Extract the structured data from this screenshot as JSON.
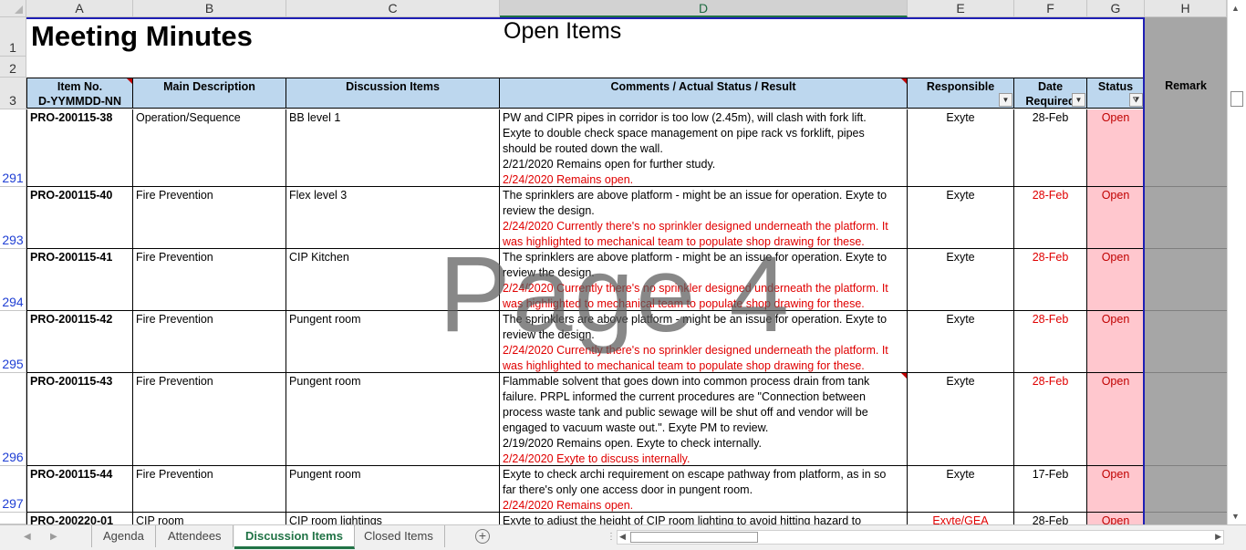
{
  "columns": [
    "A",
    "B",
    "C",
    "D",
    "E",
    "F",
    "G",
    "H"
  ],
  "selected_column": "D",
  "row_numbers": [
    "1",
    "2",
    "3",
    "291",
    "293",
    "294",
    "295",
    "296",
    "297"
  ],
  "title": "Meeting Minutes",
  "subtitle": "Open Items",
  "watermark": "Page 4",
  "headers": {
    "item_no": "Item No.",
    "item_no_format": "D-YYMMDD-NN",
    "main_description": "Main Description",
    "discussion_items": "Discussion Items",
    "comments": "Comments / Actual Status / Result",
    "responsible": "Responsible",
    "date_required": "Date Required",
    "status": "Status",
    "remark": "Remark"
  },
  "rows": [
    {
      "item": "PRO-200115-38",
      "main": "Operation/Sequence",
      "discussion": "BB level 1",
      "comment_lines": [
        "PW and CIPR pipes in corridor is too low (2.45m), will clash with fork lift.",
        "Exyte to double check space management on pipe rack vs forklift, pipes",
        "should be routed down the wall.",
        "2/21/2020 Remains open for further study."
      ],
      "comment_red": [
        "2/24/2020 Remains open."
      ],
      "responsible": "Exyte",
      "date": "28-Feb",
      "status": "Open"
    },
    {
      "item": "PRO-200115-40",
      "main": "Fire Prevention",
      "discussion": "Flex level 3",
      "comment_lines": [
        "The sprinklers are above platform - might be an issue for operation. Exyte to",
        "review the design."
      ],
      "comment_red": [
        "2/24/2020 Currently there's no sprinkler designed underneath the platform. It",
        "was highlighted to mechanical team to populate shop drawing for these."
      ],
      "responsible": "Exyte",
      "date": "28-Feb",
      "status": "Open"
    },
    {
      "item": "PRO-200115-41",
      "main": "Fire Prevention",
      "discussion": "CIP Kitchen",
      "comment_lines": [
        "The sprinklers are above platform - might be an issue for operation. Exyte to",
        "review the design."
      ],
      "comment_red": [
        "2/24/2020 Currently there's no sprinkler designed underneath the platform. It",
        "was highlighted to mechanical team to populate shop drawing for these."
      ],
      "responsible": "Exyte",
      "date": "28-Feb",
      "status": "Open"
    },
    {
      "item": "PRO-200115-42",
      "main": "Fire Prevention",
      "discussion": "Pungent room",
      "comment_lines": [
        "The sprinklers are above platform - might be an issue for operation. Exyte to",
        "review the design."
      ],
      "comment_red": [
        "2/24/2020 Currently there's no sprinkler designed underneath the platform. It",
        "was highlighted to mechanical team to populate shop drawing for these."
      ],
      "responsible": "Exyte",
      "date": "28-Feb",
      "status": "Open"
    },
    {
      "item": "PRO-200115-43",
      "main": "Fire Prevention",
      "discussion": "Pungent room",
      "comment_lines": [
        "Flammable solvent that goes down into common process drain from tank",
        "failure. PRPL informed the current procedures are \"Connection between",
        "process waste tank and public sewage will be shut off and vendor will be",
        "engaged to vacuum waste out.\". Exyte PM to review.",
        "2/19/2020 Remains open. Exyte to check internally."
      ],
      "comment_red": [
        "2/24/2020 Exyte to discuss internally."
      ],
      "responsible": "Exyte",
      "date": "28-Feb",
      "status": "Open"
    },
    {
      "item": "PRO-200115-44",
      "main": "Fire Prevention",
      "discussion": "Pungent room",
      "comment_lines": [
        "Exyte to check archi requirement on escape pathway from platform, as in so",
        "far there's only one access door in pungent room."
      ],
      "comment_red": [
        "2/24/2020 Remains open."
      ],
      "responsible": "Exyte",
      "date": "17-Feb",
      "status": "Open"
    },
    {
      "item": "PRO-200220-01",
      "main": "CIP room",
      "discussion": "CIP room lightings",
      "comment_lines": [
        "Exyte to adjust the height of CIP room lighting to avoid hitting hazard to"
      ],
      "comment_red": [],
      "responsible": "Exyte/GEA",
      "date": "28-Feb",
      "status": "Open"
    }
  ],
  "sheet_tabs": [
    "Agenda",
    "Attendees",
    "Discussion Items",
    "Closed Items"
  ],
  "active_tab": "Discussion Items",
  "colors": {
    "header_fill": "#bdd7ee",
    "status_fill": "#ffc7ce",
    "status_text": "#c00000",
    "accent": "#217346"
  }
}
